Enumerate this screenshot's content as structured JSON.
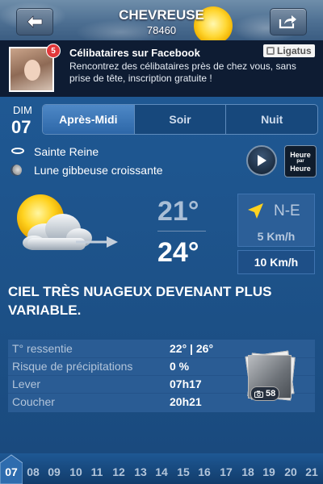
{
  "header": {
    "city": "CHEVREUSE",
    "postcode": "78460"
  },
  "ad": {
    "title": "Célibataires sur Facebook",
    "text": "Rencontrez des célibataires près de chez vous, sans prise de tête, inscription gratuite !",
    "badge": "5",
    "logo": "Ligatus"
  },
  "day": {
    "label": "DIM",
    "number": "07"
  },
  "tabs": [
    {
      "label": "Après-Midi",
      "active": true
    },
    {
      "label": "Soir",
      "active": false
    },
    {
      "label": "Nuit",
      "active": false
    }
  ],
  "info": {
    "saint": "Sainte Reine",
    "moon": "Lune gibbeuse croissante"
  },
  "hour_button": {
    "top": "Heure",
    "mid": "par",
    "bottom": "Heure"
  },
  "forecast": {
    "temp_low": "21°",
    "temp_high": "24°",
    "wind_direction": "N-E",
    "wind_speed": "5 Km/h",
    "gust_speed": "10 Km/h",
    "description": "CIEL TRÈS NUAGEUX DEVENANT PLUS VARIABLE."
  },
  "details": [
    {
      "label": "T° ressentie",
      "value": "22° | 26°"
    },
    {
      "label": "Risque de précipitations",
      "value": "0 %"
    },
    {
      "label": "Lever",
      "value": "07h17"
    },
    {
      "label": "Coucher",
      "value": "20h21"
    }
  ],
  "photos": {
    "count": "58"
  },
  "hours": [
    "07",
    "08",
    "09",
    "10",
    "11",
    "12",
    "13",
    "14",
    "15",
    "16",
    "17",
    "18",
    "19",
    "20",
    "21"
  ],
  "colors": {
    "background": "#1b4f86",
    "active_tab": "#3a76b8",
    "sun": "#ffd733",
    "wind_arrow": "#ffd21f"
  }
}
